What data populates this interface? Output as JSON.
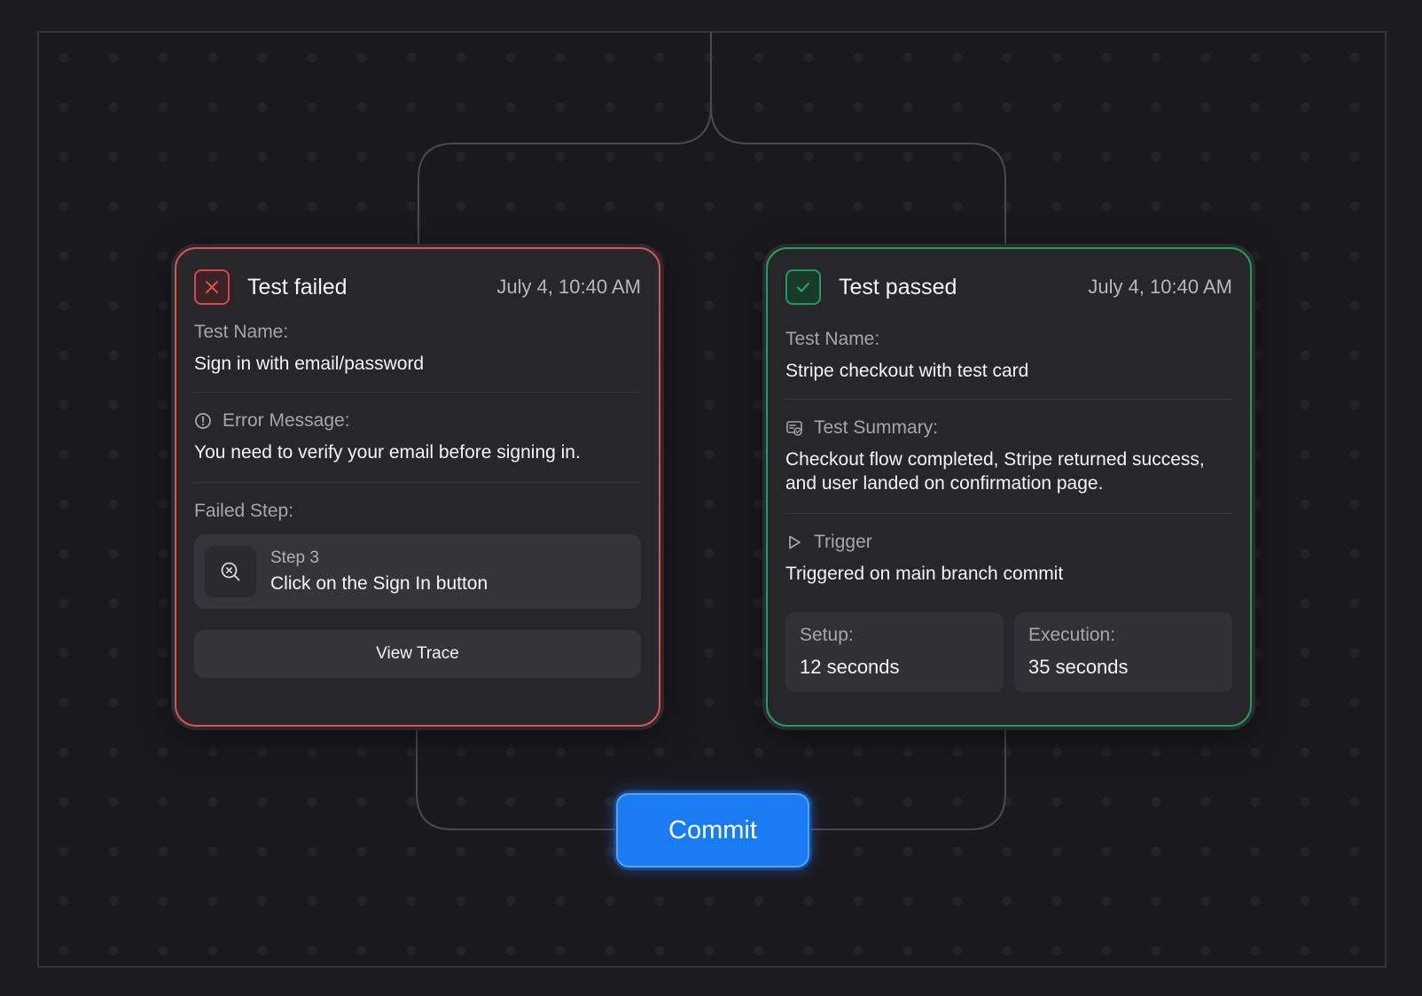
{
  "failed_card": {
    "status_icon": "close-icon",
    "status_color": "#e0504f",
    "title": "Test failed",
    "time": "July 4, 10:40 AM",
    "test_name_label": "Test Name:",
    "test_name": "Sign in with email/password",
    "error_label": "Error Message:",
    "error_icon": "alert-circle-icon",
    "error_message": "You need to verify your email before signing in.",
    "failed_step_label": "Failed Step:",
    "step_icon": "search-x-icon",
    "step_number": "Step 3",
    "step_description": "Click on the Sign In button",
    "view_trace_label": "View Trace"
  },
  "passed_card": {
    "status_icon": "check-icon",
    "status_color": "#1fa05a",
    "title": "Test passed",
    "time": "July 4, 10:40 AM",
    "test_name_label": "Test Name:",
    "test_name": "Stripe checkout with test card",
    "summary_label": "Test Summary:",
    "summary_icon": "summary-icon",
    "summary_line1": "Checkout flow completed, Stripe returned success,",
    "summary_line2": "and user landed on confirmation page.",
    "trigger_label": "Trigger",
    "trigger_icon": "play-icon",
    "trigger_value": "Triggered on main branch commit",
    "setup_label": "Setup:",
    "setup_value": "12 seconds",
    "execution_label": "Execution:",
    "execution_value": "35 seconds"
  },
  "commit_button": {
    "label": "Commit",
    "color": "#1a7cf3"
  }
}
